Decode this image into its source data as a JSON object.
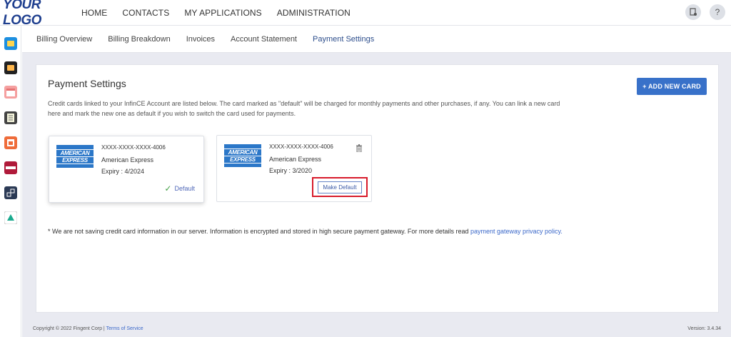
{
  "app": {
    "logo_part1": "Y",
    "logo_part2": "OUR LOGO"
  },
  "topnav": {
    "items": [
      "HOME",
      "CONTACTS",
      "MY APPLICATIONS",
      "ADMINISTRATION"
    ],
    "help_label": "?"
  },
  "subnav": {
    "tabs": [
      "Billing Overview",
      "Billing Breakdown",
      "Invoices",
      "Account Statement",
      "Payment Settings"
    ],
    "active": "Payment Settings"
  },
  "page": {
    "title": "Payment Settings",
    "description": "Credit cards linked to your InfinCE Account are listed below. The card marked as \"default\" will be charged for monthly payments and other purchases, if any. You can link a new card here and mark the new one as default if you wish to switch the card used for payments.",
    "add_button": "+ ADD NEW CARD"
  },
  "cards": [
    {
      "logo_line1": "AMERICAN",
      "logo_line2": "EXPRESS",
      "number": "XXXX-XXXX-XXXX-4006",
      "brand": "American Express",
      "expiry": "Expiry : 4/2024",
      "status_label": "Default",
      "check_glyph": "✓"
    },
    {
      "logo_line1": "AMERICAN",
      "logo_line2": "EXPRESS",
      "number": "XXXX-XXXX-XXXX-4006",
      "brand": "American Express",
      "expiry": "Expiry : 3/2020",
      "action_label": "Make Default"
    }
  ],
  "footnote": {
    "text": "* We are not saving credit card information in our server. Information is encrypted and stored in high secure payment gateway. For more details read ",
    "link": "payment gateway privacy policy."
  },
  "footer": {
    "copyright": "Copyright © 2022 Fingent Corp | ",
    "terms": "Terms of Service",
    "version": "Version: 3.4.34"
  },
  "colors": {
    "accent": "#3871c9",
    "amex_blue": "#2b77c8",
    "highlight_red": "#d81b2b",
    "default_green": "#43a047"
  }
}
